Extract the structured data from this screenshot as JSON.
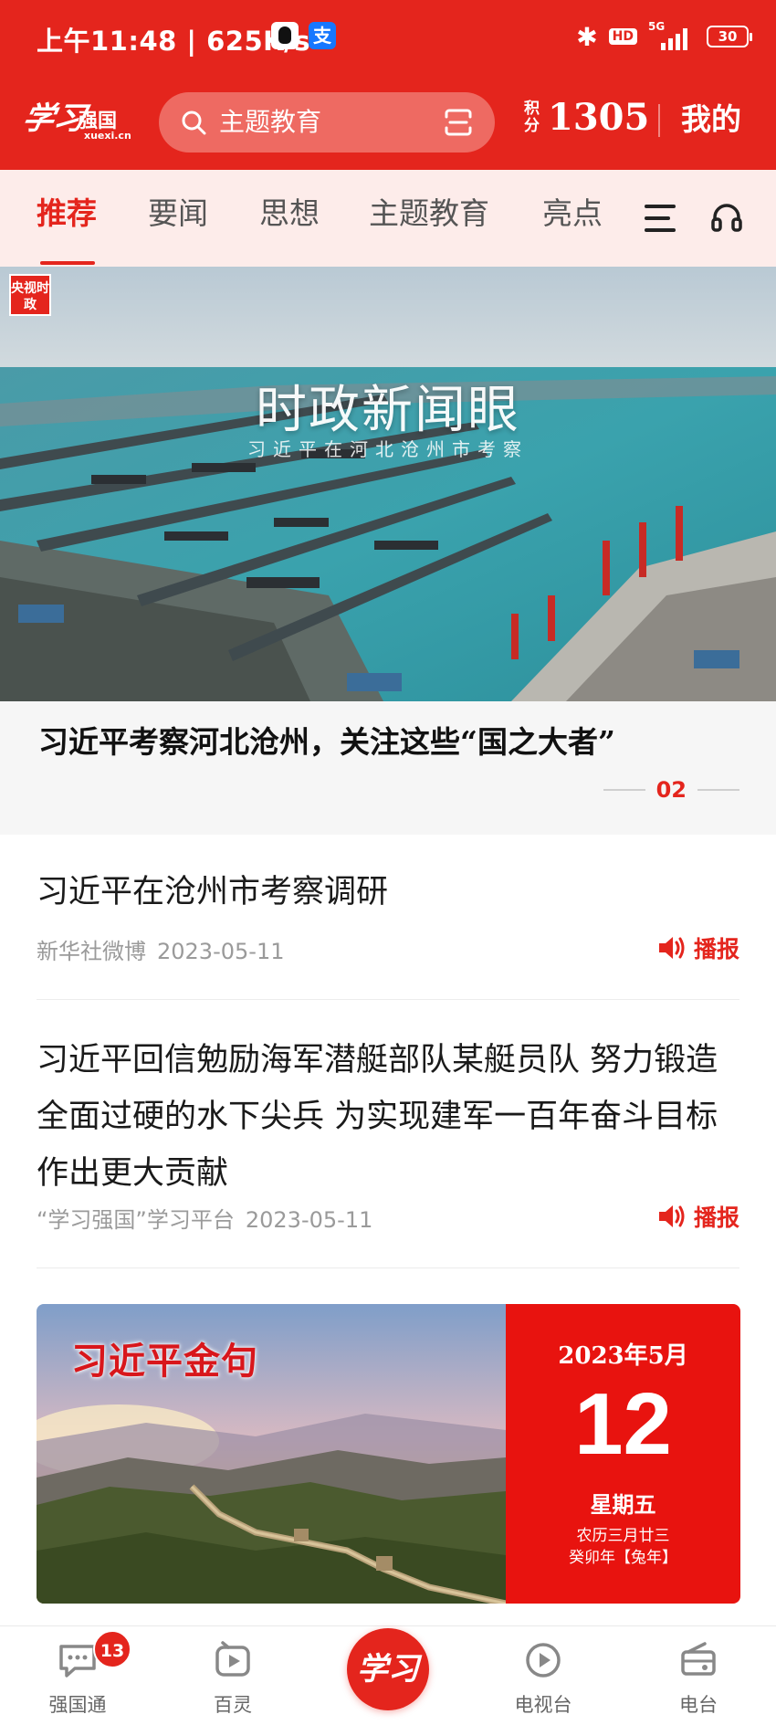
{
  "status_bar": {
    "time": "上午11:48 | 625K/s",
    "alipay_glyph": "支",
    "hd": "HD",
    "network": "5G",
    "battery": "30"
  },
  "app_bar": {
    "logo_script": "学习",
    "logo_sub": "强国",
    "logo_domain": "xuexi.cn",
    "search_placeholder": "主题教育",
    "score_label": "积分",
    "score_value": "1305",
    "mine": "我的"
  },
  "tabs": [
    {
      "label": "推荐",
      "active": true
    },
    {
      "label": "要闻",
      "active": false
    },
    {
      "label": "思想",
      "active": false
    },
    {
      "label": "主题教育",
      "active": false
    },
    {
      "label": "亮点",
      "active": false
    }
  ],
  "hero": {
    "source_badge": "央视时政",
    "title": "时政新闻眼",
    "subtitle": "习近平在河北沧州市考察",
    "caption": "习近平考察河北沧州，关注这些“国之大者”",
    "page": "02"
  },
  "articles": [
    {
      "title": "习近平在沧州市考察调研",
      "source": "新华社微博",
      "date": "2023-05-11",
      "action": "播报"
    },
    {
      "title": "习近平回信勉励海军潜艇部队某艇员队 努力锻造全面过硬的水下尖兵 为实现建军一百年奋斗目标作出更大贡献",
      "source": "“学习强国”学习平台",
      "date": "2023-05-11",
      "action": "播报"
    }
  ],
  "quote_card": {
    "title": "习近平金句",
    "year_month": "2023年5月",
    "day": "12",
    "weekday": "星期五",
    "lunar_line1": "农历三月廿三",
    "lunar_line2": "癸卯年【兔年】"
  },
  "bottom_nav": [
    {
      "label": "强国通",
      "badge": "13"
    },
    {
      "label": "百灵"
    },
    {
      "label": "学习"
    },
    {
      "label": "电视台"
    },
    {
      "label": "电台"
    }
  ],
  "colors": {
    "brand_red": "#e4251d",
    "tab_bg": "#fdecea",
    "meta_gray": "#9a9a9a"
  }
}
